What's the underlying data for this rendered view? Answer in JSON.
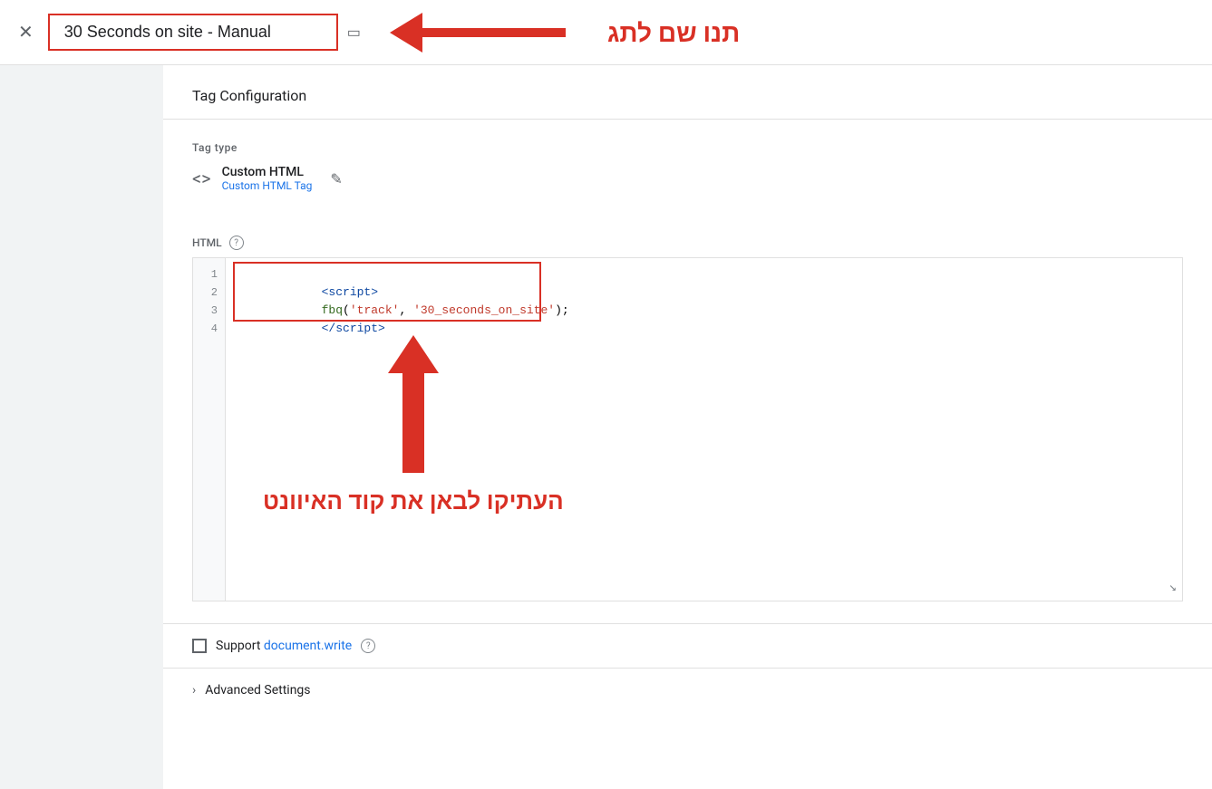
{
  "topbar": {
    "close_label": "✕",
    "tag_name": "30 Seconds on site - Manual",
    "folder_icon": "▭"
  },
  "annotation": {
    "top_right_text": "תנו שם לתג",
    "bottom_text": "העתיקו לבאן את קוד האיוונט"
  },
  "tag_config": {
    "section_title": "Tag Configuration",
    "tag_type_label": "Tag type",
    "tag_type_name": "Custom HTML",
    "tag_type_sub": "Custom HTML Tag",
    "html_label": "HTML",
    "help_icon": "?",
    "code_lines": [
      "<script>",
      "fbq('track', '30_seconds_on_site');",
      "<\\/script>",
      ""
    ],
    "line_numbers": [
      "1",
      "2",
      "3",
      "4"
    ],
    "resize_icon": "↘"
  },
  "support_doc": {
    "label_prefix": "Support ",
    "label_link": "document.write",
    "help_icon": "?"
  },
  "advanced": {
    "label": "Advanced Settings"
  }
}
